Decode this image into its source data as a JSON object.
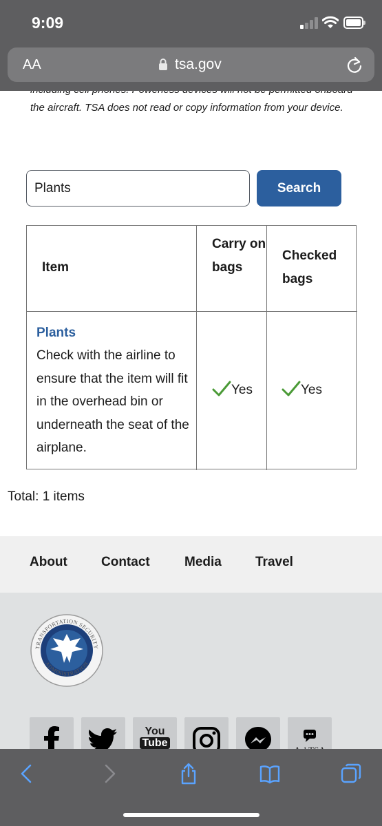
{
  "status_bar": {
    "time": "9:09"
  },
  "browser": {
    "text_size_label": "AA",
    "domain": "tsa.gov",
    "toolbar": [
      "back-icon",
      "forward-icon",
      "share-icon",
      "bookmarks-icon",
      "tabs-icon"
    ]
  },
  "page": {
    "intro_text": "including cell phones. Powerless devices will not be permitted onboard the aircraft. TSA does not read or copy information from your device.",
    "search": {
      "value": "Plants",
      "button_label": "Search"
    },
    "table": {
      "headers": {
        "item": "Item",
        "carry_on": "Carry on bags",
        "checked": "Checked bags"
      },
      "rows": [
        {
          "name": "Plants",
          "description": "Check with the airline to ensure that the item will fit in the overhead bin or underneath the seat of the airplane.",
          "carry_on": "Yes",
          "checked": "Yes"
        }
      ]
    },
    "total": "Total: 1 items"
  },
  "footer": {
    "nav": [
      "About",
      "Contact",
      "Media",
      "Travel"
    ],
    "seal_text": "TRANSPORTATION SECURITY ADMINISTRATION",
    "social": {
      "facebook": "facebook-icon",
      "twitter": "twitter-icon",
      "youtube_line1": "You",
      "youtube_line2": "Tube",
      "instagram": "instagram-icon",
      "messenger": "messenger-icon",
      "asktsa": "AskTSA"
    }
  },
  "colors": {
    "accent": "#2c5f9e",
    "check": "#4a9a36",
    "chrome": "#5e5e60",
    "footer_nav_bg": "#f0f0f0",
    "footer_bg": "#dfe1e2"
  }
}
